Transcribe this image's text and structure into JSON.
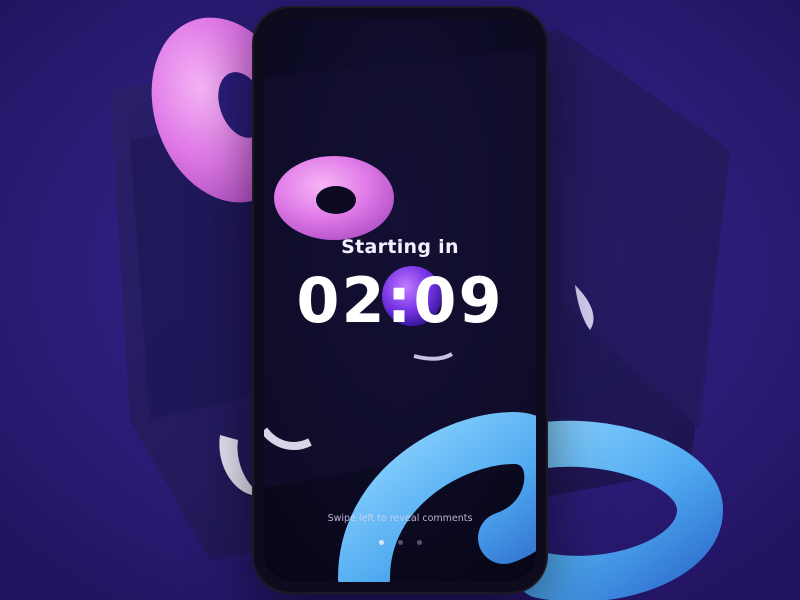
{
  "countdown": {
    "title": "Starting in",
    "time": "02:09"
  },
  "footer": {
    "hint": "Swipe left to reveal comments",
    "page_indicator": {
      "total": 3,
      "active_index": 0
    }
  },
  "colors": {
    "background": "#2b1a78",
    "pink_torus": "#e07ae8",
    "blue_torus": "#4fa9f0",
    "purple_sphere": "#8a3ff0",
    "phone_frame": "#0d0b1c"
  }
}
